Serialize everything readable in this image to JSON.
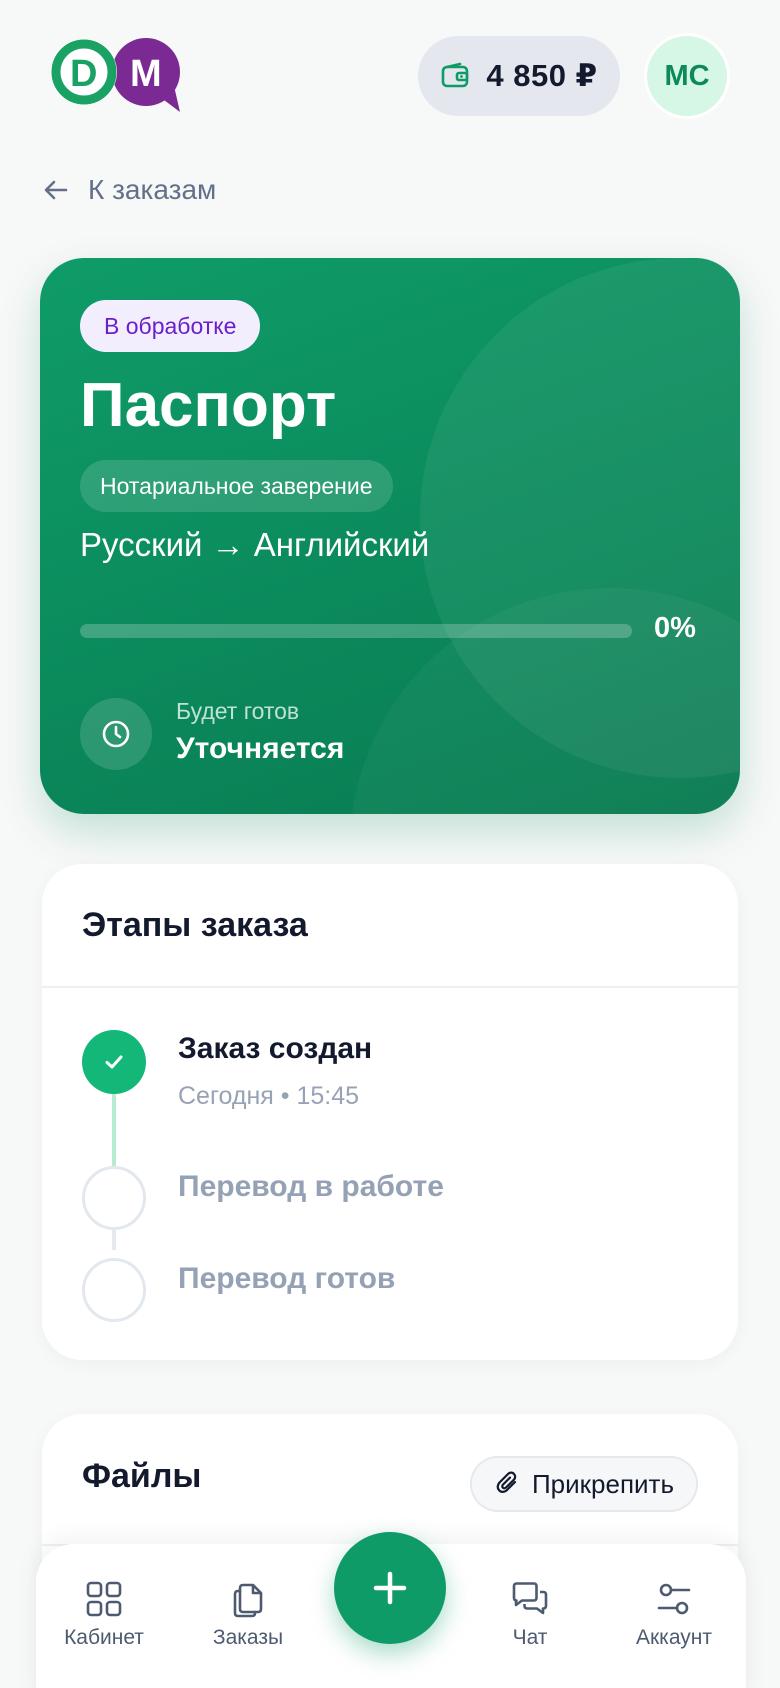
{
  "header": {
    "logo_text": "DM",
    "balance": "4 850 ₽",
    "avatar_initials": "МС"
  },
  "nav": {
    "back_label": "К заказам"
  },
  "order": {
    "status": "В обработке",
    "title": "Паспорт",
    "service": "Нотариальное заверение",
    "languages": "Русский → Английский",
    "progress_value": 0,
    "progress_label": "0%",
    "eta_caption": "Будет готов",
    "eta_value": "Уточняется"
  },
  "steps": {
    "title": "Этапы заказа",
    "items": [
      {
        "label": "Заказ создан",
        "time": "Сегодня • 15:45",
        "state": "done"
      },
      {
        "label": "Перевод в работе",
        "state": "todo"
      },
      {
        "label": "Перевод готов",
        "state": "todo"
      }
    ]
  },
  "files": {
    "title": "Файлы",
    "attach_label": "Прикрепить"
  },
  "bottom_nav": {
    "items": [
      {
        "label": "Кабинет",
        "icon": "grid-icon"
      },
      {
        "label": "Заказы",
        "icon": "documents-icon"
      },
      {
        "label": "Чат",
        "icon": "chat-icon"
      },
      {
        "label": "Аккаунт",
        "icon": "sliders-icon"
      }
    ],
    "fab_icon": "plus-icon"
  },
  "colors": {
    "brand_green": "#0e9b68",
    "brand_purple": "#7b2a93",
    "status_purple": "#6b1fc9",
    "background": "#f7f8f8"
  }
}
